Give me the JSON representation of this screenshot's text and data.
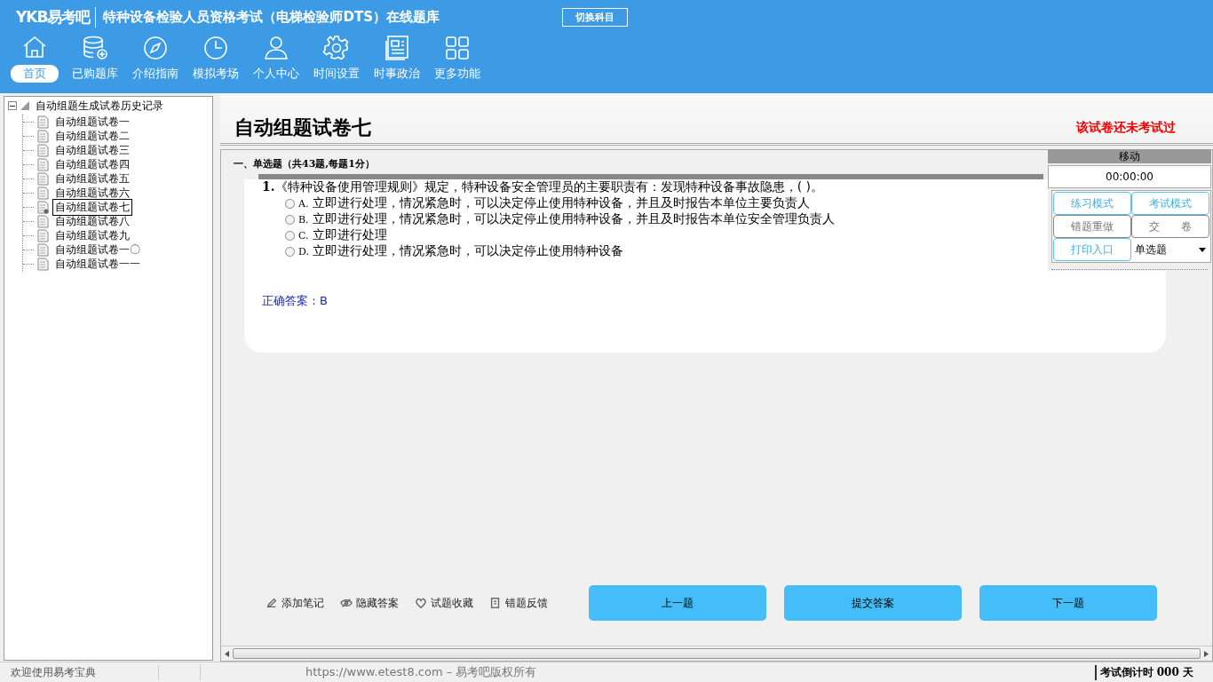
{
  "header": {
    "logo": "YKB易考吧",
    "title": "特种设备检验人员资格考试（电梯检验师DTS）在线题库",
    "switch_button": "切换科目"
  },
  "nav": [
    {
      "label": "首页",
      "selected": true
    },
    {
      "label": "已购题库",
      "selected": false
    },
    {
      "label": "介绍指南",
      "selected": false
    },
    {
      "label": "模拟考场",
      "selected": false
    },
    {
      "label": "个人中心",
      "selected": false
    },
    {
      "label": "时间设置",
      "selected": false
    },
    {
      "label": "时事政治",
      "selected": false
    },
    {
      "label": "更多功能",
      "selected": false
    }
  ],
  "tree": {
    "label": "自动组题生成试卷历史记录",
    "expanded": true,
    "children": [
      {
        "label": "自动组题试卷一",
        "selected": false
      },
      {
        "label": "自动组题试卷二",
        "selected": false
      },
      {
        "label": "自动组题试卷三",
        "selected": false
      },
      {
        "label": "自动组题试卷四",
        "selected": false
      },
      {
        "label": "自动组题试卷五",
        "selected": false
      },
      {
        "label": "自动组题试卷六",
        "selected": false
      },
      {
        "label": "自动组题试卷七",
        "selected": true
      },
      {
        "label": "自动组题试卷八",
        "selected": false
      },
      {
        "label": "自动组题试卷九",
        "selected": false
      },
      {
        "label": "自动组题试卷一〇",
        "selected": false
      },
      {
        "label": "自动组题试卷一一",
        "selected": false
      }
    ]
  },
  "paper": {
    "title": "自动组题试卷七",
    "status": "该试卷还未考试过",
    "section": "一、单选题（共43题,每题1分）",
    "question": {
      "number": "1.",
      "text": "《特种设备使用管理规则》规定，特种设备安全管理员的主要职责有：发现特种设备事故隐患，( )。",
      "options": [
        {
          "letter": "A.",
          "text": "立即进行处理，情况紧急时，可以决定停止使用特种设备，并且及时报告本单位主要负责人",
          "selected": false
        },
        {
          "letter": "B.",
          "text": "立即进行处理，情况紧急时，可以决定停止使用特种设备，并且及时报告本单位安全管理负责人",
          "selected": false
        },
        {
          "letter": "C.",
          "text": "立即进行处理",
          "selected": false
        },
        {
          "letter": "D.",
          "text": "立即进行处理，情况紧急时，可以决定停止使用特种设备",
          "selected": false
        }
      ],
      "answer": "正确答案：B"
    }
  },
  "control_panel": {
    "title": "移动",
    "timer": "00:00:00",
    "buttons": [
      {
        "label": "练习模式",
        "disabled": false
      },
      {
        "label": "考试模式",
        "disabled": false
      },
      {
        "label": "错题重做",
        "disabled": true
      },
      {
        "label": "交　　卷",
        "disabled": true
      },
      {
        "label": "打印入口",
        "disabled": false
      }
    ],
    "type_select": "单选题"
  },
  "tools": [
    "添加笔记",
    "隐藏答案",
    "试题收藏",
    "错题反馈"
  ],
  "actions": [
    "上一题",
    "提交答案",
    "下一题"
  ],
  "status_bar": {
    "welcome": "欢迎使用易考宝典",
    "copyright": "https://www.etest8.com – 易考吧版权所有",
    "countdown": "考试倒计时 000 天"
  }
}
